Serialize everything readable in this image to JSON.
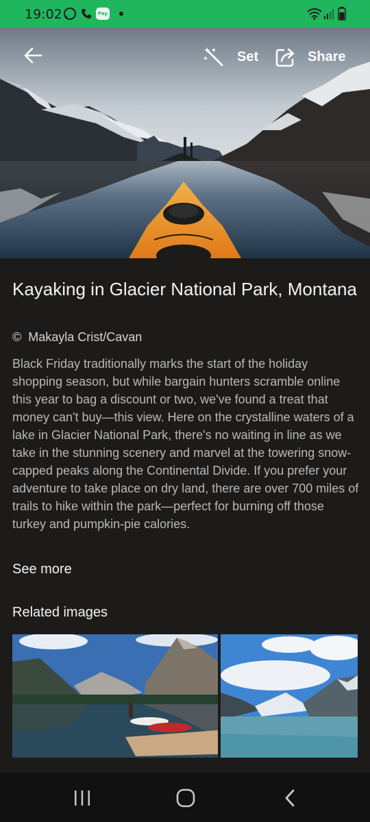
{
  "status_bar": {
    "time": "19:02",
    "pay_label": "Pay",
    "icons": [
      "whatsapp-icon",
      "phone-icon",
      "pay-icon",
      "notification-dot",
      "wifi-icon",
      "signal-icon",
      "battery-icon"
    ],
    "color": "#1fb65d"
  },
  "toolbar": {
    "set_label": "Set",
    "share_label": "Share"
  },
  "article": {
    "title": "Kayaking in Glacier National Park, Montana",
    "copyright_symbol": "©",
    "credit": "Makayla Crist/Cavan",
    "description": "Black Friday traditionally marks the start of the holiday shopping season, but while bargain hunters scramble online this year to bag a discount or two, we've found a treat that money can't buy—this view. Here on the crystalline waters of a lake in Glacier National Park, there's no waiting in line as we take in the stunning scenery and marvel at the towering snow-capped peaks along the Continental Divide. If you prefer your adventure to take place on dry land, there are over 700 miles of trails to hike within the park—perfect for burning off those turkey and pumpkin-pie calories.",
    "see_more": "See more",
    "related_title": "Related images"
  },
  "nav": {
    "icons": [
      "recent-apps-icon",
      "home-icon",
      "back-icon"
    ]
  }
}
